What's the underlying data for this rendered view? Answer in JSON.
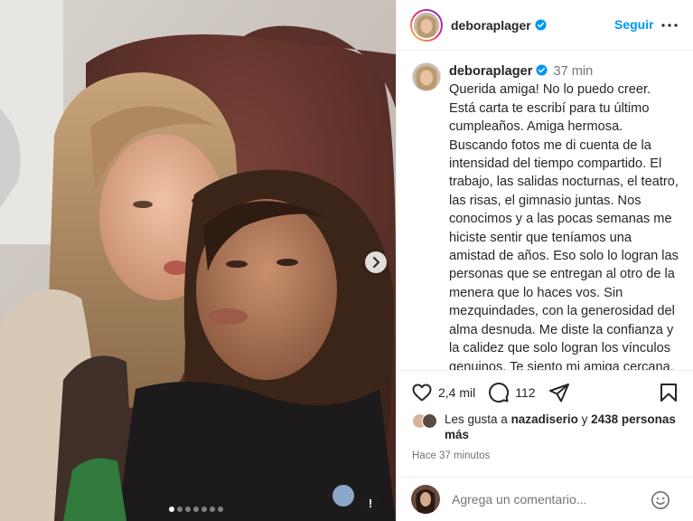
{
  "post": {
    "slides_count": 7,
    "active_slide": 0,
    "info_glyph": "!"
  },
  "header": {
    "username": "deboraplager",
    "follow_label": "Seguir"
  },
  "caption": {
    "username": "deboraplager",
    "time": "37 min",
    "text": "Querida amiga! No lo puedo creer. Está carta te escribí para tu último cumpleaños. Amiga hermosa. Buscando fotos me di cuenta de la intensidad del tiempo compartido. El trabajo, las salidas nocturnas, el teatro, las risas, el gimnasio juntas. Nos conocimos y a las pocas semanas me hiciste sentir que teníamos una amistad de años. Eso solo lo logran las personas que se entregan al otro de la menera que lo haces vos. Sin mezquindades, con la generosidad del alma desnuda. Me diste la confianza y la calidez que solo logran los vínculos genuinos. Te siento mi amiga cercana, tan intensa como cuando compartíamos mucho tiempo juntas. Lo reafirma el tiempo que llevo sin verte,"
  },
  "actions": {
    "likes_count": "2,4 mil",
    "comments_count": "112",
    "icons": [
      "heart-icon",
      "comment-icon",
      "share-icon",
      "save-icon"
    ]
  },
  "likes": {
    "prefix": "Les gusta a ",
    "user": "nazadiserio",
    "middle": " y ",
    "others": "2438 personas más"
  },
  "timestamp": "Hace 37 minutos",
  "comment": {
    "placeholder": "Agrega un comentario..."
  },
  "colors": {
    "accent": "#0095f6",
    "verified": "#0095f6",
    "text": "#262626",
    "muted": "#737373"
  }
}
